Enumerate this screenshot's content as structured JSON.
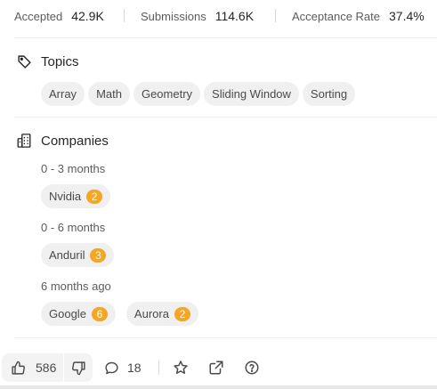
{
  "stats": {
    "accepted_label": "Accepted",
    "accepted_value": "42.9K",
    "submissions_label": "Submissions",
    "submissions_value": "114.6K",
    "acceptance_label": "Acceptance Rate",
    "acceptance_value": "37.4%"
  },
  "topics": {
    "title": "Topics",
    "icon": "tag-icon",
    "items": [
      "Array",
      "Math",
      "Geometry",
      "Sliding Window",
      "Sorting"
    ]
  },
  "companies": {
    "title": "Companies",
    "icon": "building-icon",
    "groups": [
      {
        "period": "0 - 3 months",
        "items": [
          {
            "name": "Nvidia",
            "count": "2"
          }
        ]
      },
      {
        "period": "0 - 6 months",
        "items": [
          {
            "name": "Anduril",
            "count": "3"
          }
        ]
      },
      {
        "period": "6 months ago",
        "items": [
          {
            "name": "Google",
            "count": "6"
          },
          {
            "name": "Aurora",
            "count": "2"
          }
        ]
      }
    ]
  },
  "actions": {
    "upvotes": "586",
    "comments": "18",
    "icons": [
      "thumbs-up-icon",
      "thumbs-down-icon",
      "comment-icon",
      "star-icon",
      "share-icon",
      "help-icon"
    ]
  },
  "colors": {
    "badge": "#f5a623",
    "chip_bg": "#f0f0f0",
    "text": "#262626",
    "muted": "#5c5c5c"
  }
}
